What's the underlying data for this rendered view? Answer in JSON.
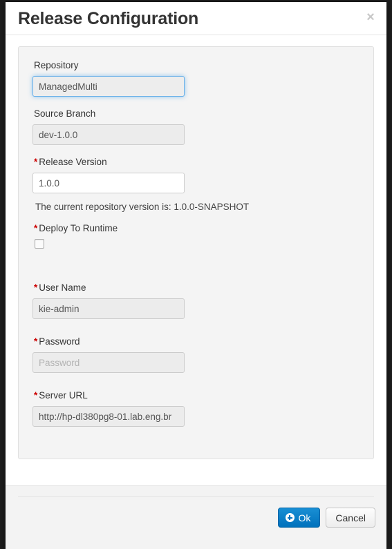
{
  "dialog": {
    "title": "Release Configuration",
    "close_icon": "close-icon",
    "close_label": "×"
  },
  "form": {
    "repository": {
      "label": "Repository",
      "value": "ManagedMulti",
      "required": false,
      "state": "focused"
    },
    "source_branch": {
      "label": "Source Branch",
      "value": "dev-1.0.0",
      "required": false,
      "state": "disabled"
    },
    "release_version": {
      "required_marker": "*",
      "label": "Release Version",
      "value": "1.0.0",
      "state": "enabled"
    },
    "version_help": "The current repository version is: 1.0.0-SNAPSHOT",
    "deploy_to_runtime": {
      "required_marker": "*",
      "label": "Deploy To Runtime",
      "checked": false
    },
    "user_name": {
      "required_marker": "*",
      "label": "User Name",
      "value": "kie-admin",
      "state": "disabled"
    },
    "password": {
      "required_marker": "*",
      "label": "Password",
      "value": "",
      "placeholder": "Password",
      "state": "disabled"
    },
    "server_url": {
      "required_marker": "*",
      "label": "Server URL",
      "value": "http://hp-dl380pg8-01.lab.eng.br",
      "state": "disabled"
    }
  },
  "footer": {
    "ok_label": "Ok",
    "ok_icon": "circle-plus-icon",
    "cancel_label": "Cancel"
  },
  "colors": {
    "primary": "#0071bc",
    "required": "#cc0000",
    "focus_ring": "#66afe9",
    "panel_bg": "#f4f4f4",
    "footer_bg": "#f3f3f3"
  }
}
